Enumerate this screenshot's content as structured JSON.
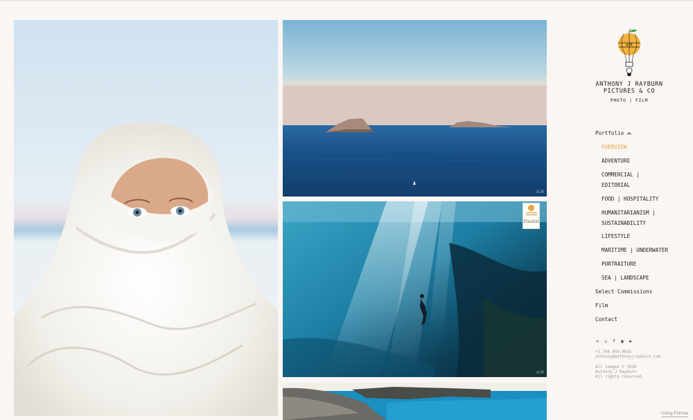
{
  "brand": {
    "name_line1": "ANTHONY J RAYBURN",
    "name_line2": "PICTURES & CO",
    "sub": "PHOTO | FILM",
    "logo_letters": "AJR",
    "accent": "#e8a33c"
  },
  "nav": {
    "portfolio": "Portfolio",
    "sub_items": [
      {
        "label": "OVERVIEW",
        "active": true
      },
      {
        "label": "ADVENTURE"
      },
      {
        "label": "COMMERCIAL |"
      },
      {
        "label": "EDITORIAL"
      },
      {
        "label": "FOOD | HOSPITALITY"
      },
      {
        "label": "HUMANITARIANISM |"
      },
      {
        "label": "SUSTAINABILITY"
      },
      {
        "label": "LIFESTYLE"
      },
      {
        "label": "MARITIME | UNDERWATER"
      },
      {
        "label": "PORTRAITURE"
      },
      {
        "label": "SEA | LANDSCAPE"
      }
    ],
    "select_commissions": "Select Commissions",
    "film": "Film",
    "contact": "Contact"
  },
  "social_icons": [
    "tripadvisor-icon",
    "instagram-icon",
    "facebook-icon",
    "vimeo-icon",
    "youtube-icon"
  ],
  "contact": {
    "phone": "+1.760.450.0815",
    "email": "anthony@anthonyjrayburn.com",
    "copyright_1": "All images © 2020",
    "copyright_2": "Anthony J Rayburn",
    "copyright_3": "All rights reserved."
  },
  "award_badge": {
    "label": "Finalist"
  },
  "footer": {
    "using_format": "Using Format"
  }
}
